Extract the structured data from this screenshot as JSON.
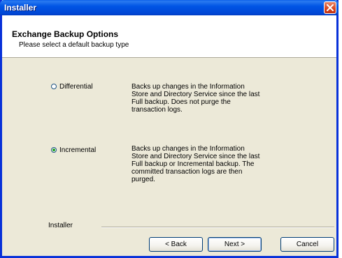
{
  "window": {
    "title": "Installer",
    "close_icon": "close-icon",
    "title_bar_color": "#0055e5"
  },
  "header": {
    "title": "Exchange Backup Options",
    "subtitle": "Please select a default backup type"
  },
  "options": [
    {
      "label": "Differential",
      "checked": false,
      "description": [
        "Backs up changes in the Information",
        "Store and Directory Service since the last",
        "Full backup. Does not purge the",
        "transaction logs."
      ]
    },
    {
      "label": "Incremental",
      "checked": true,
      "description": [
        "Backs up changes in the Information",
        "Store and Directory Service since the last",
        "Full backup or Incremental backup. The",
        "committed transaction logs are then",
        "purged."
      ]
    }
  ],
  "footer": {
    "group_label": "Installer",
    "back_label": "< Back",
    "next_label": "Next >",
    "cancel_label": "Cancel"
  }
}
